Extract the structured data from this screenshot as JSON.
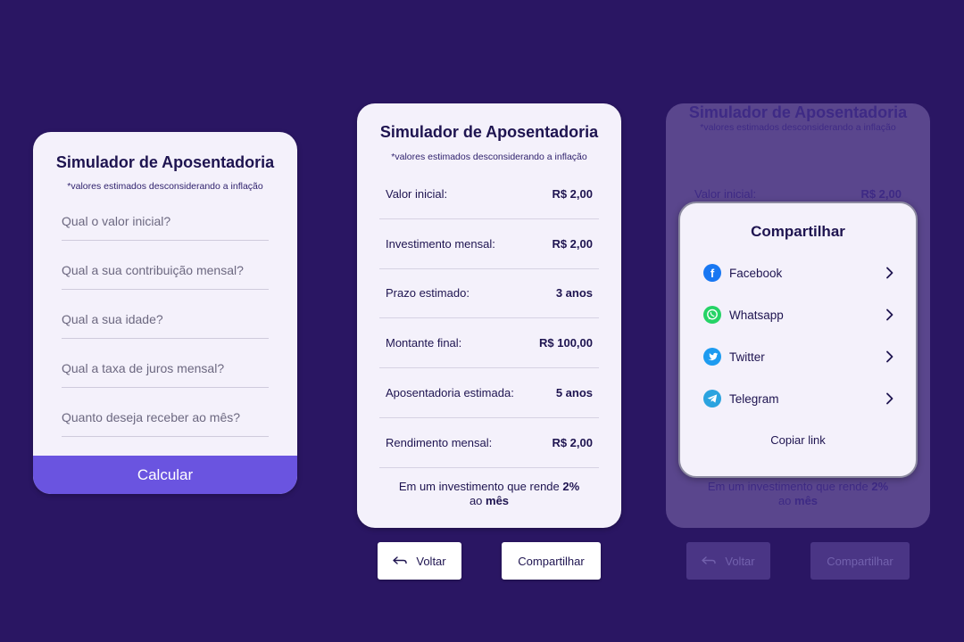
{
  "form": {
    "title": "Simulador de Aposentadoria",
    "subtitle": "*valores estimados desconsiderando a inflação",
    "fields": [
      {
        "placeholder": "Qual o valor inicial?",
        "value": ""
      },
      {
        "placeholder": "Qual a sua contribuição mensal?",
        "value": ""
      },
      {
        "placeholder": "Qual a sua idade?",
        "value": ""
      },
      {
        "placeholder": "Qual a taxa de juros mensal?",
        "value": ""
      },
      {
        "placeholder": "Quanto deseja receber ao mês?",
        "value": ""
      }
    ],
    "calculate_label": "Calcular"
  },
  "result": {
    "title": "Simulador de Aposentadoria",
    "subtitle": "*valores estimados desconsiderando a inflação",
    "rows": [
      {
        "label": "Valor inicial:",
        "value": "R$ 2,00"
      },
      {
        "label": "Investimento mensal:",
        "value": "R$ 2,00"
      },
      {
        "label": "Prazo estimado:",
        "value": "3 anos"
      },
      {
        "label": "Montante final:",
        "value": "R$ 100,00"
      },
      {
        "label": "Aposentadoria estimada:",
        "value": "5 anos"
      },
      {
        "label": "Rendimento mensal:",
        "value": "R$ 2,00"
      }
    ],
    "note_prefix": "Em um investimento que rende ",
    "note_rate": "2%",
    "note_mid": "ao ",
    "note_period": "mês",
    "back_label": "Voltar",
    "share_label": "Compartilhar"
  },
  "share_modal": {
    "title": "Compartilhar",
    "items": [
      {
        "label": "Facebook",
        "icon": "facebook-icon",
        "color": "#1877f2"
      },
      {
        "label": "Whatsapp",
        "icon": "whatsapp-icon",
        "color": "#25d366"
      },
      {
        "label": "Twitter",
        "icon": "twitter-icon",
        "color": "#1d9bf0"
      },
      {
        "label": "Telegram",
        "icon": "telegram-icon",
        "color": "#2aa3df"
      }
    ],
    "copy_link_label": "Copiar link"
  },
  "colors": {
    "background": "#2a1663",
    "accent": "#6a54e0",
    "card": "#f4f1fb",
    "text": "#1e1450"
  }
}
